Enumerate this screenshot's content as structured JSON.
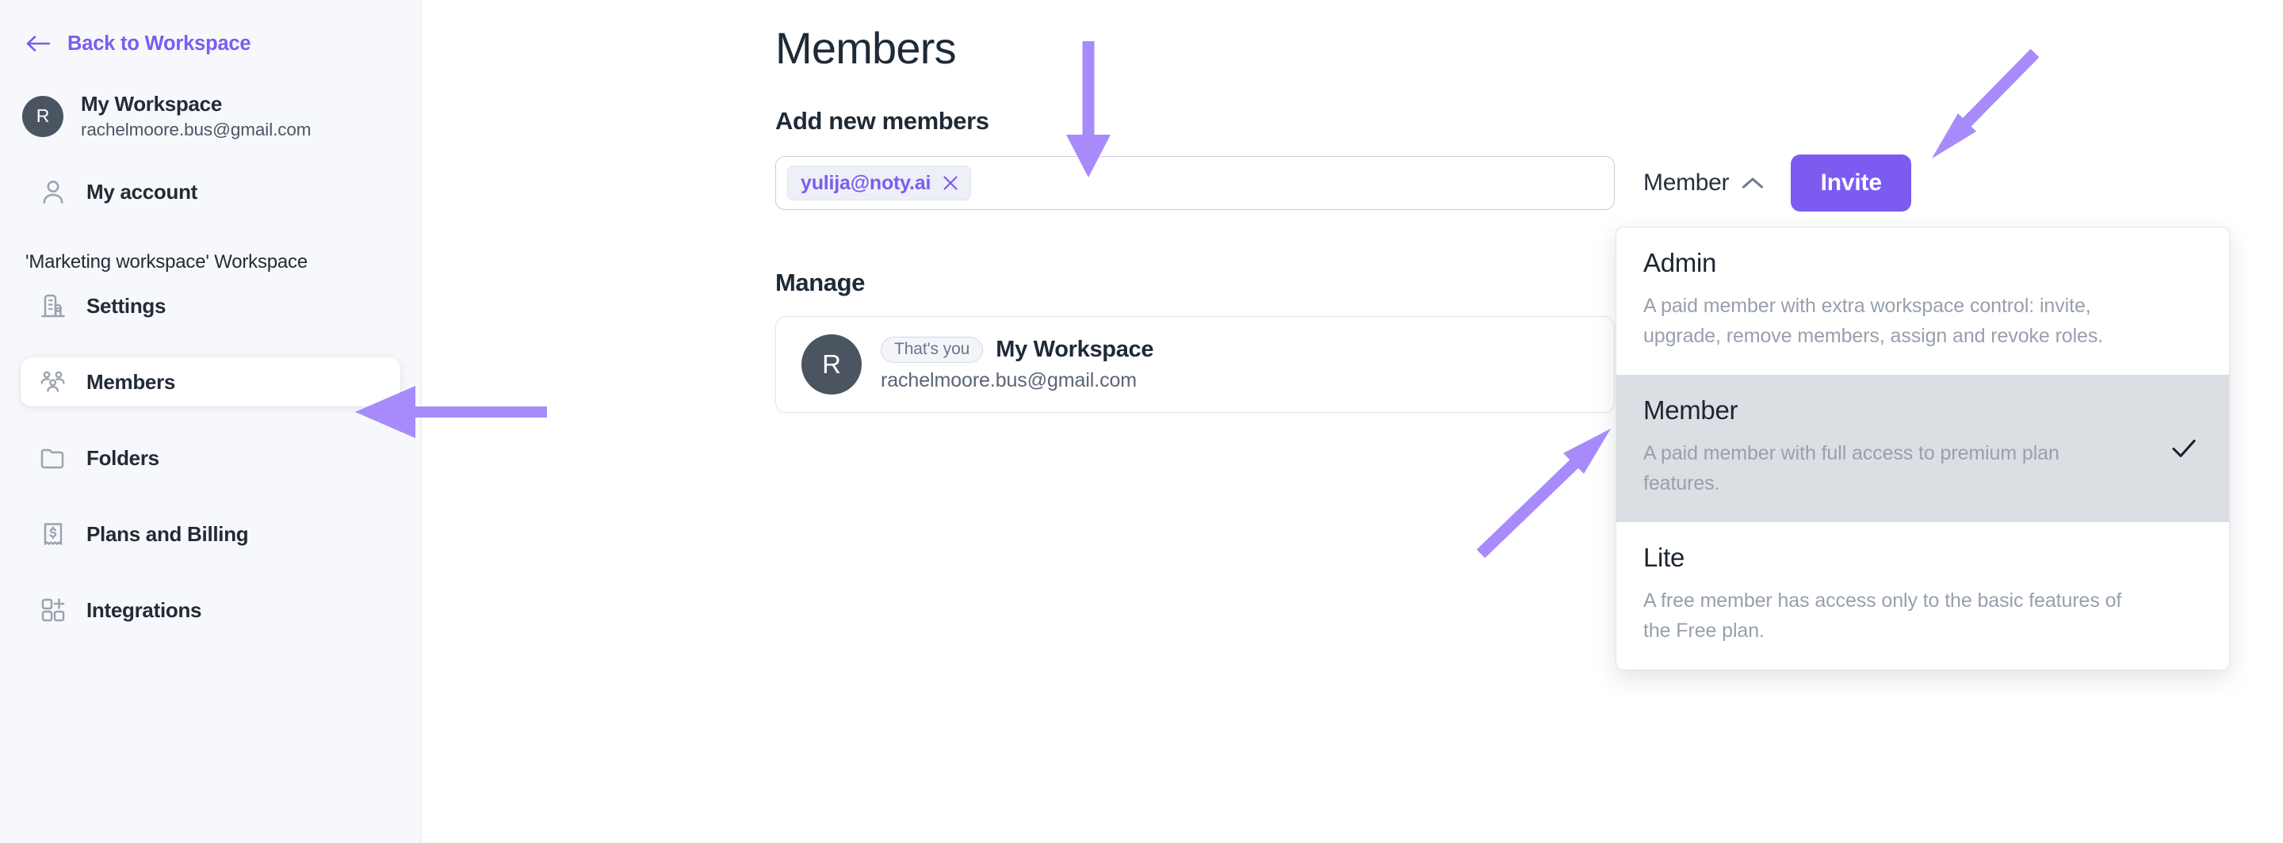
{
  "sidebar": {
    "back_link": "Back to Workspace",
    "back_icon": "arrow-left-icon",
    "workspace": {
      "avatar_initial": "R",
      "name": "My Workspace",
      "email": "rachelmoore.bus@gmail.com"
    },
    "my_account": {
      "label": "My account",
      "icon": "user-icon"
    },
    "section_label": "'Marketing workspace' Workspace",
    "items": [
      {
        "label": "Settings",
        "icon": "building-icon",
        "active": false
      },
      {
        "label": "Members",
        "icon": "users-group-icon",
        "active": true
      },
      {
        "label": "Folders",
        "icon": "folder-icon",
        "active": false
      },
      {
        "label": "Plans and Billing",
        "icon": "receipt-dollar-icon",
        "active": false
      },
      {
        "label": "Integrations",
        "icon": "grid-plus-icon",
        "active": false
      }
    ]
  },
  "main": {
    "page_title": "Members",
    "add_new_members_label": "Add new members",
    "email_input": {
      "placeholder": "",
      "chips": [
        {
          "text": "yulija@noty.ai",
          "remove_icon": "close-icon"
        }
      ]
    },
    "role_select": {
      "value": "Member",
      "icon": "chevron-up-icon"
    },
    "invite_button": "Invite",
    "manage_label": "Manage",
    "member_card": {
      "avatar_initial": "R",
      "you_badge": "That's you",
      "name": "My Workspace",
      "email": "rachelmoore.bus@gmail.com"
    }
  },
  "dropdown": {
    "options": [
      {
        "title": "Admin",
        "description": "A paid member with extra workspace control: invite, upgrade, remove members, assign and revoke roles.",
        "selected": false
      },
      {
        "title": "Member",
        "description": "A paid member with full access to premium plan features.",
        "selected": true
      },
      {
        "title": "Lite",
        "description": "A free member has access only to the basic features of the Free plan.",
        "selected": false
      }
    ],
    "check_icon": "check-icon"
  },
  "annotations": {
    "color": "#a78bfa",
    "arrows": [
      {
        "name": "arrow-to-email-input",
        "direction": "down"
      },
      {
        "name": "arrow-to-invite-button",
        "direction": "down-left"
      },
      {
        "name": "arrow-to-members-nav",
        "direction": "left"
      },
      {
        "name": "arrow-to-member-option",
        "direction": "up-right"
      }
    ]
  },
  "colors": {
    "accent": "#7c5cf0",
    "sidebar_bg": "#f7f8fc",
    "annotation": "#a78bfa",
    "text_dark": "#1f2a37",
    "text_muted": "#97a0ad"
  }
}
